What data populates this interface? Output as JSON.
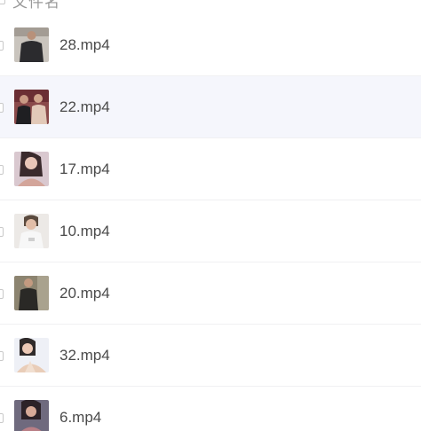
{
  "header": {
    "label": "文件名"
  },
  "files": [
    {
      "name": "28.mp4",
      "thumb_icon": "video-thumbnail-icon"
    },
    {
      "name": "22.mp4",
      "thumb_icon": "video-thumbnail-icon"
    },
    {
      "name": "17.mp4",
      "thumb_icon": "video-thumbnail-icon"
    },
    {
      "name": "10.mp4",
      "thumb_icon": "video-thumbnail-icon"
    },
    {
      "name": "20.mp4",
      "thumb_icon": "video-thumbnail-icon"
    },
    {
      "name": "32.mp4",
      "thumb_icon": "video-thumbnail-icon"
    },
    {
      "name": "6.mp4",
      "thumb_icon": "video-thumbnail-icon"
    }
  ],
  "colors": {
    "hover_row": "#f5f6fc",
    "text": "#4a4a4a",
    "divider": "#f0f0f2"
  }
}
